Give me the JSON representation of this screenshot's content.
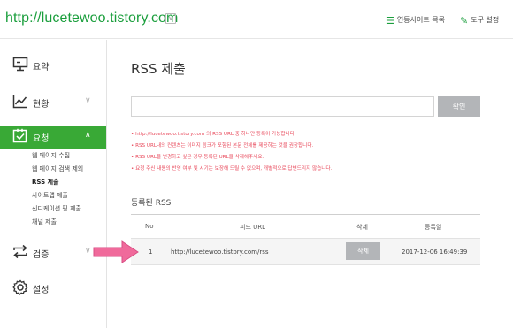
{
  "header": {
    "site_url": "http://lucetewoo.tistory.com",
    "linked_sites_label": "연동사이트 목록",
    "tools_label": "도구 설정"
  },
  "sidebar": {
    "summary": "요약",
    "status": "현황",
    "request": "요청",
    "request_sub": [
      "웹 페이지 수집",
      "웹 페이지 검색 제외",
      "RSS 제출",
      "사이트맵 제출",
      "신디케이션 핑 제출",
      "채널 제출"
    ],
    "verify": "검증",
    "settings": "설정"
  },
  "main": {
    "title": "RSS 제출",
    "input_value": "",
    "confirm_label": "확인",
    "notes": [
      "• http://lucetewoo.tistory.com 의 RSS URL 중 하나만 등록이 가능합니다.",
      "• RSS URL내의 컨텐츠는 이미지 링크가 포함된 본문 전체를 제공하는 것을 권장합니다.",
      "• RSS URL을 변경하고 싶은 경우 등록된 URL을 삭제해주세요.",
      "• 요청 주신 내용의 반영 여부 및 시기는 보장해 드릴 수 없으며, 개별적으로 답변드리지 않습니다."
    ],
    "section_title": "등록된 RSS",
    "table": {
      "headers": [
        "No",
        "피드 URL",
        "삭제",
        "등록일"
      ],
      "rows": [
        {
          "no": "1",
          "url": "http://lucetewoo.tistory.com/rss",
          "delete": "삭제",
          "date": "2017-12-06 16:49:39"
        }
      ]
    }
  },
  "colors": {
    "brand_green": "#39a936",
    "note_red": "#e8485a",
    "arrow_pink": "#f06a9b"
  }
}
